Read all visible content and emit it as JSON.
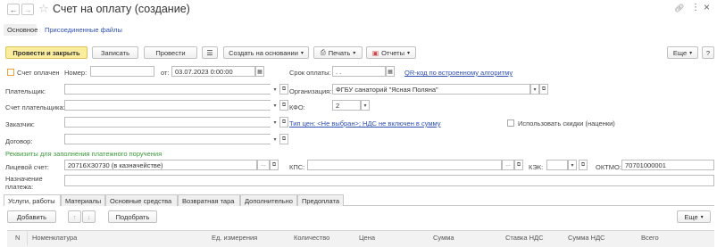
{
  "header": {
    "back_glyph": "←",
    "forward_glyph": "→",
    "title": "Счет на оплату (создание)",
    "link_glyph": "⊘",
    "more_glyph": "⋮",
    "close_glyph": "×"
  },
  "nav_tabs": {
    "main": "Основное",
    "files": "Присоединенные файлы"
  },
  "toolbar": {
    "post_close": "Провести и закрыть",
    "save": "Записать",
    "post": "Провести",
    "create_based": "Создать на основании",
    "print": "Печать",
    "reports": "Отчеты",
    "more": "Еще",
    "help": "?"
  },
  "form": {
    "paid_label": "Счет оплачен",
    "number_label": "Номер:",
    "number_value": "",
    "from_label": "от:",
    "date_value": "03.07.2023  0:00:00",
    "due_label": "Срок оплаты:",
    "due_value": ". .",
    "qr_link": "QR-код по встроенному алгоритму",
    "payer_label": "Плательщик:",
    "payer_value": "",
    "org_label": "Организация:",
    "org_value": "ФГБУ санаторий \"Ясная Поляна\"",
    "payer_account_label": "Счет плательщика:",
    "payer_account_value": "",
    "kfo_label": "КФО:",
    "kfo_value": "2",
    "customer_label": "Заказчик:",
    "customer_value": "",
    "price_type_link": "Тип цен: <Не выбран>; НДС не включен в сумму",
    "discounts_label": "Использовать скидки (наценки)",
    "contract_label": "Договор:",
    "contract_value": "",
    "requisites_header": "Реквизиты для заполнения платежного поручения",
    "personal_account_label": "Лицевой счет:",
    "personal_account_value": "20716Х30730 (в казначействе)",
    "kps_label": "КПС:",
    "kps_value": "",
    "kek_label": "КЭК:",
    "kek_value": "",
    "oktmo_label": "ОКТМО:",
    "oktmo_value": "70701000001",
    "purpose_label": "Назначение платежа:",
    "purpose_value": ""
  },
  "tabs": [
    "Услуги, работы",
    "Материалы",
    "Основные средства",
    "Возвратная тара",
    "Дополнительно",
    "Предоплата"
  ],
  "table_toolbar": {
    "add": "Добавить",
    "pick": "Подобрать",
    "more": "Еще"
  },
  "table_headers": [
    "N",
    "Номенклатура",
    "Ед. измерения",
    "Количество",
    "Цена",
    "Сумма",
    "Ставка НДС",
    "Сумма НДС",
    "Всего"
  ]
}
